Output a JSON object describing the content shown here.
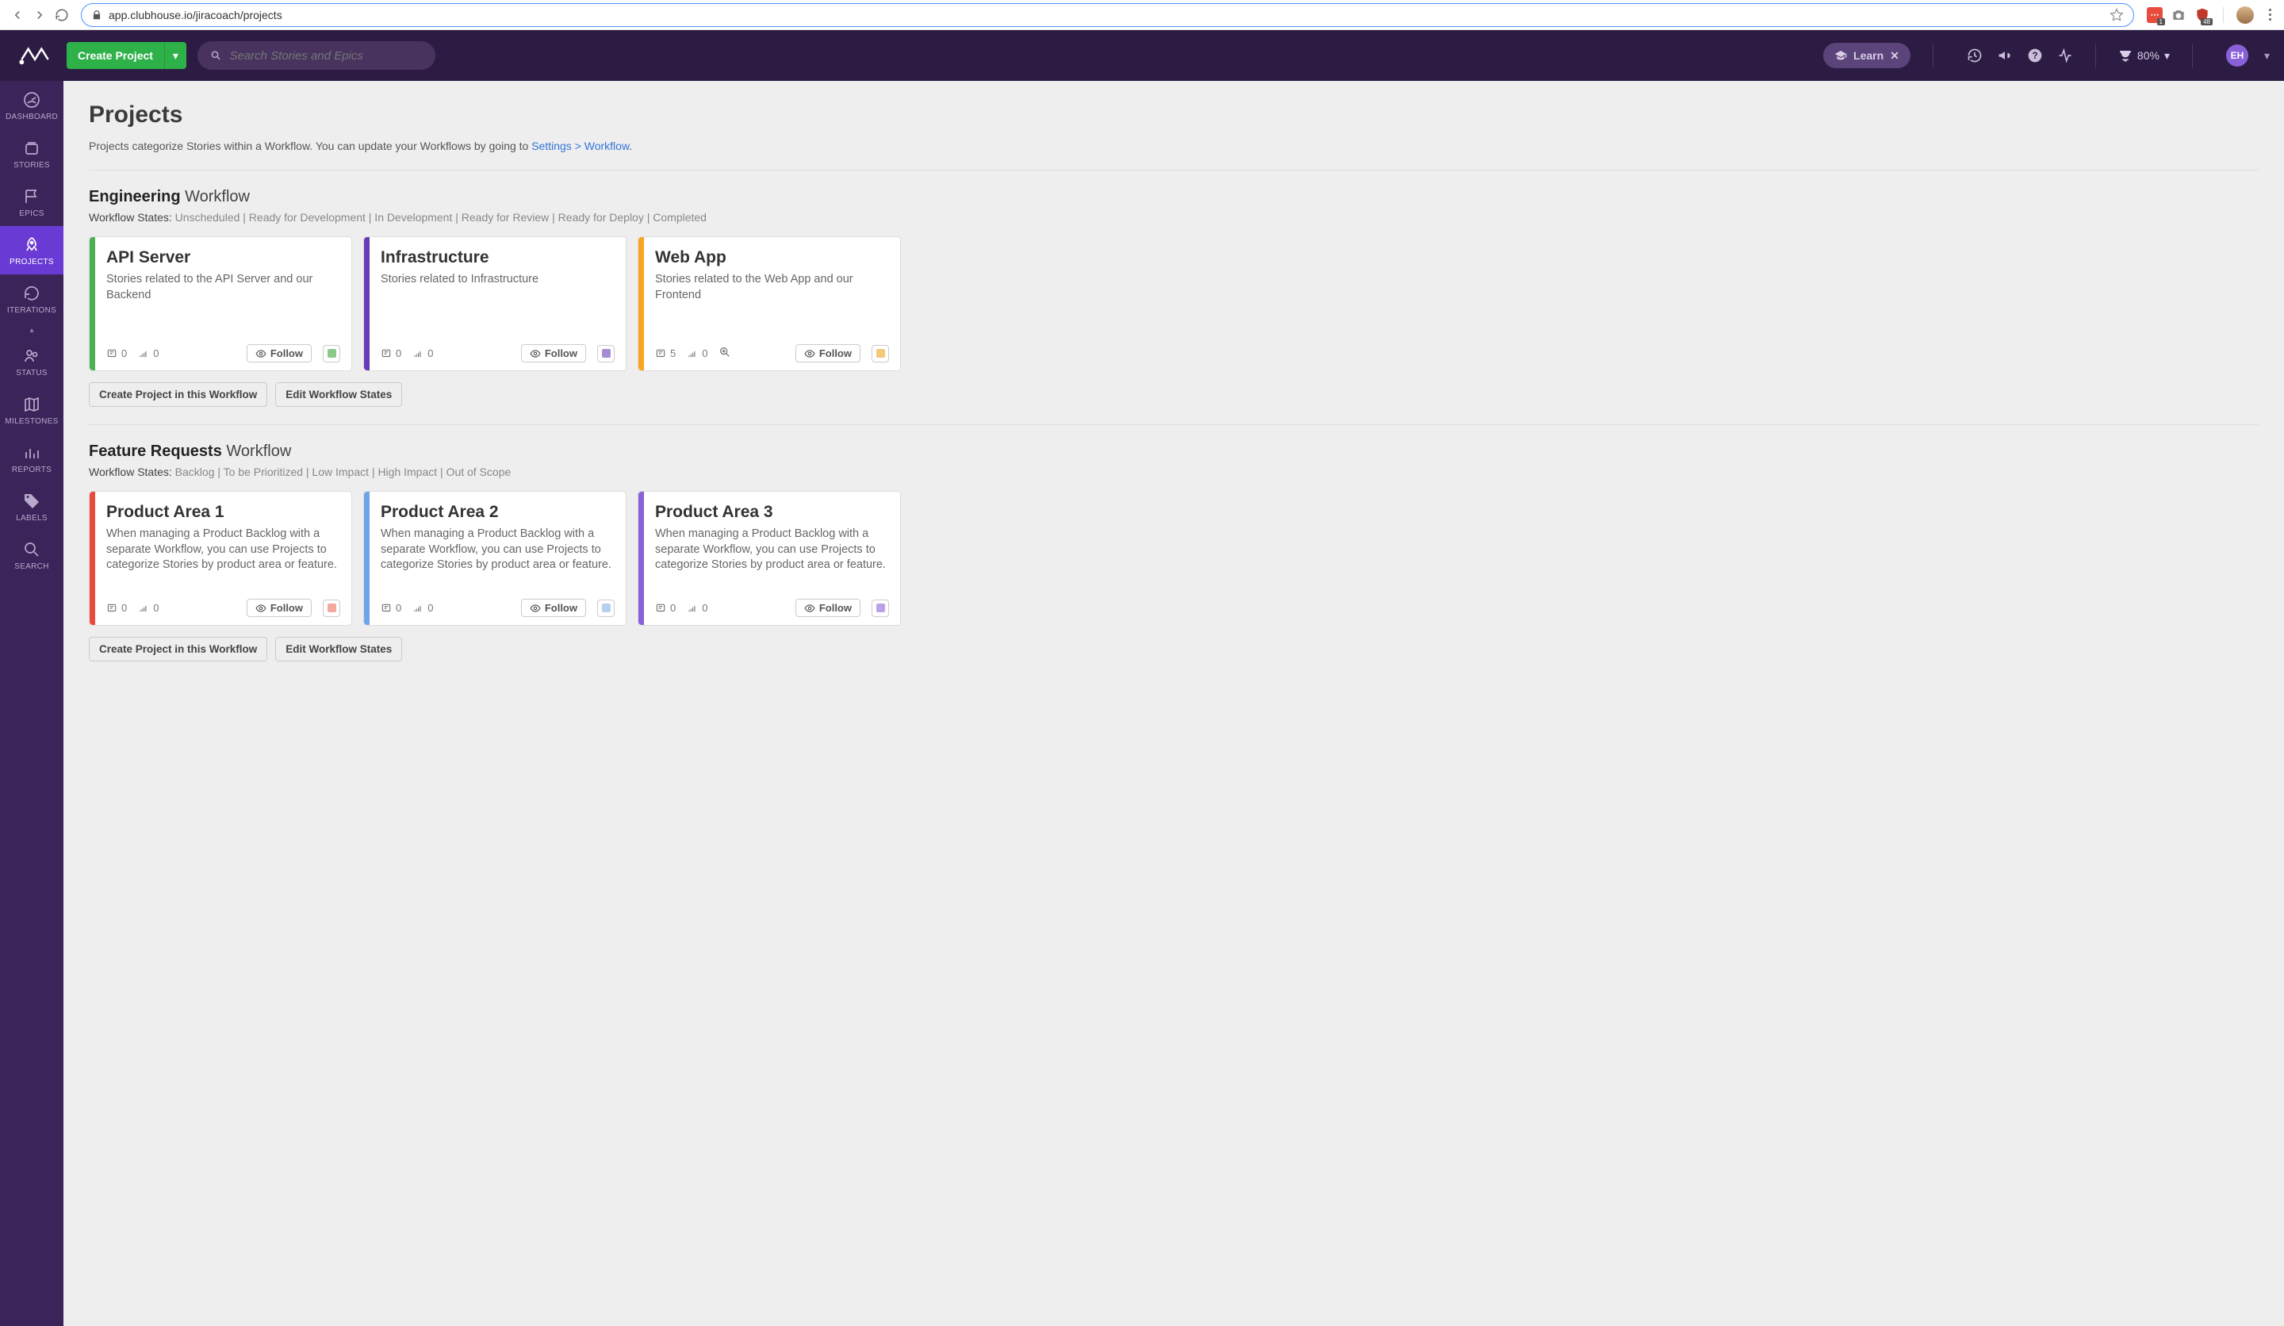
{
  "browser": {
    "url": "app.clubhouse.io/jiracoach/projects",
    "ext_badge1": "1",
    "ext_badge2": "48"
  },
  "header": {
    "create_label": "Create Project",
    "search_placeholder": "Search Stories and Epics",
    "learn_label": "Learn",
    "trophy_pct": "80%",
    "user_initials": "EH"
  },
  "sidebar": {
    "items": [
      {
        "label": "DASHBOARD"
      },
      {
        "label": "STORIES"
      },
      {
        "label": "EPICS"
      },
      {
        "label": "PROJECTS"
      },
      {
        "label": "ITERATIONS"
      },
      {
        "label": "STATUS"
      },
      {
        "label": "MILESTONES"
      },
      {
        "label": "REPORTS"
      },
      {
        "label": "LABELS"
      },
      {
        "label": "SEARCH"
      }
    ]
  },
  "page": {
    "title": "Projects",
    "desc_prefix": "Projects categorize Stories within a Workflow. You can update your Workflows by going to ",
    "desc_link": "Settings > Workflow",
    "desc_suffix": "."
  },
  "workflows": [
    {
      "name": "Engineering",
      "suffix": "Workflow",
      "states_label": "Workflow States: ",
      "states": "Unscheduled | Ready for Development | In Development | Ready for Review | Ready for Deploy | Completed",
      "create_btn": "Create Project in this Workflow",
      "edit_btn": "Edit Workflow States",
      "projects": [
        {
          "title": "API Server",
          "desc": "Stories related to the API Server and our Backend",
          "stripe": "#4caf50",
          "chip": "#8bc98b",
          "stories": "0",
          "points": "0",
          "follow": "Follow",
          "zoom": false
        },
        {
          "title": "Infrastructure",
          "desc": "Stories related to Infrastructure",
          "stripe": "#673ab7",
          "chip": "#a58dd6",
          "stories": "0",
          "points": "0",
          "follow": "Follow",
          "zoom": false
        },
        {
          "title": "Web App",
          "desc": "Stories related to the Web App and our Frontend",
          "stripe": "#f5a623",
          "chip": "#f3c97a",
          "stories": "5",
          "points": "0",
          "follow": "Follow",
          "zoom": true
        }
      ]
    },
    {
      "name": "Feature Requests",
      "suffix": "Workflow",
      "states_label": "Workflow States: ",
      "states": "Backlog | To be Prioritized | Low Impact | High Impact | Out of Scope",
      "create_btn": "Create Project in this Workflow",
      "edit_btn": "Edit Workflow States",
      "projects": [
        {
          "title": "Product Area 1",
          "desc": "When managing a Product Backlog with a separate Workflow, you can use Projects to categorize Stories by product area or feature.",
          "stripe": "#e74c3c",
          "chip": "#f3a99f",
          "stories": "0",
          "points": "0",
          "follow": "Follow",
          "zoom": false
        },
        {
          "title": "Product Area 2",
          "desc": "When managing a Product Backlog with a separate Workflow, you can use Projects to categorize Stories by product area or feature.",
          "stripe": "#6fa4e8",
          "chip": "#b7d0ef",
          "stories": "0",
          "points": "0",
          "follow": "Follow",
          "zoom": false
        },
        {
          "title": "Product Area 3",
          "desc": "When managing a Product Backlog with a separate Workflow, you can use Projects to categorize Stories by product area or feature.",
          "stripe": "#8a60d8",
          "chip": "#b9a2e6",
          "stories": "0",
          "points": "0",
          "follow": "Follow",
          "zoom": false
        }
      ]
    }
  ]
}
